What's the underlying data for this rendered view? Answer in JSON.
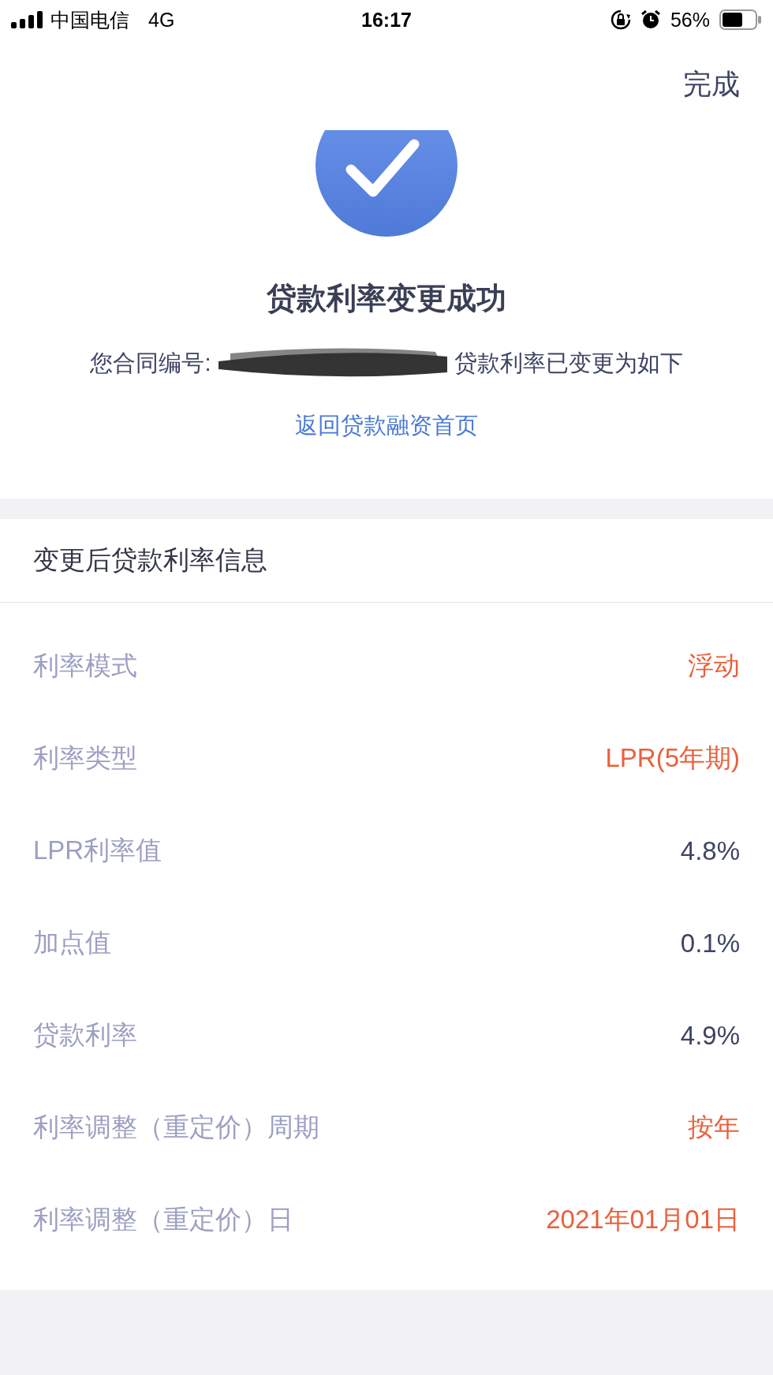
{
  "status_bar": {
    "carrier": "中国电信",
    "network": "4G",
    "time": "16:17",
    "battery": "56%"
  },
  "nav": {
    "done": "完成"
  },
  "result": {
    "title": "贷款利率变更成功",
    "message_before": "您合同编号:",
    "message_after": "贷款利率已变更为如下",
    "link": "返回贷款融资首页"
  },
  "section": {
    "title": "变更后贷款利率信息",
    "rows": [
      {
        "label": "利率模式",
        "value": "浮动",
        "kind": "highlight"
      },
      {
        "label": "利率类型",
        "value": "LPR(5年期)",
        "kind": "highlight"
      },
      {
        "label": "LPR利率值",
        "value": "4.8%",
        "kind": "plain"
      },
      {
        "label": "加点值",
        "value": "0.1%",
        "kind": "plain"
      },
      {
        "label": "贷款利率",
        "value": "4.9%",
        "kind": "plain"
      },
      {
        "label": "利率调整（重定价）周期",
        "value": "按年",
        "kind": "highlight"
      },
      {
        "label": "利率调整（重定价）日",
        "value": "2021年01月01日",
        "kind": "highlight"
      }
    ]
  }
}
